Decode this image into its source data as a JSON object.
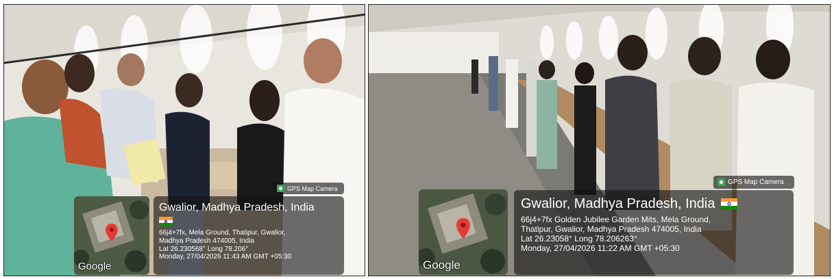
{
  "photos": [
    {
      "id": "left",
      "gps_tag_label": "GPS Map Camera",
      "map_label": "Google",
      "location_title": "Gwalior, Madhya Pradesh, India",
      "address_lines": [
        "66j4+7fx, Mela Ground, Thatipur, Gwalior,",
        "Madhya Pradesh 474005, India"
      ],
      "coordinates": "Lat 26.230568° Long 78.206°",
      "timestamp": "Monday, 27/04/2026 11:43 AM GMT +05:30"
    },
    {
      "id": "right",
      "gps_tag_label": "GPS Map Camera",
      "map_label": "Google",
      "location_title": "Gwalior, Madhya Pradesh, India",
      "address_lines": [
        "66j4+7fx Golden Jubilee Garden Mits, Mela Ground,",
        "Thatipur, Gwalior, Madhya Pradesh 474005, India"
      ],
      "coordinates": "Lat 26.23058° Long 78.206263°",
      "timestamp": "Monday, 27/04/2026 11:22 AM GMT +05:30"
    }
  ],
  "colors": {
    "overlay": "#141414",
    "flag_saffron": "#ff9933",
    "flag_white": "#ffffff",
    "flag_green": "#138808",
    "map_pin": "#e53935"
  }
}
